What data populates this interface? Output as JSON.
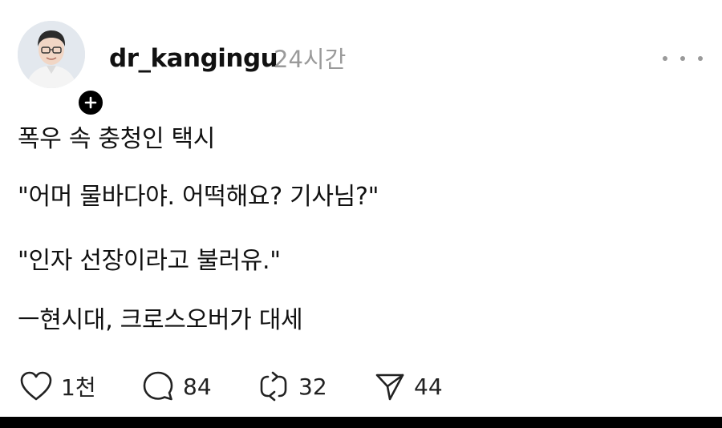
{
  "post": {
    "username": "dr_kangingu",
    "timestamp": "24시간",
    "lines": [
      "폭우 속 충청인 택시",
      "\"어머 물바다야. 어떡해요? 기사님?\"",
      "\"인자 선장이라고 불러유.\"",
      "ㅡ현시대, 크로스오버가 대세"
    ]
  },
  "actions": {
    "likes": "1천",
    "comments": "84",
    "reposts": "32",
    "shares": "44"
  },
  "icons": {
    "more": "more-horizontal-icon",
    "follow": "plus-icon",
    "like": "heart-icon",
    "comment": "comment-bubble-icon",
    "repost": "repost-icon",
    "share": "send-icon"
  },
  "colors": {
    "text": "#111111",
    "muted": "#9a9a9a",
    "badge": "#000000",
    "background": "#ffffff"
  }
}
